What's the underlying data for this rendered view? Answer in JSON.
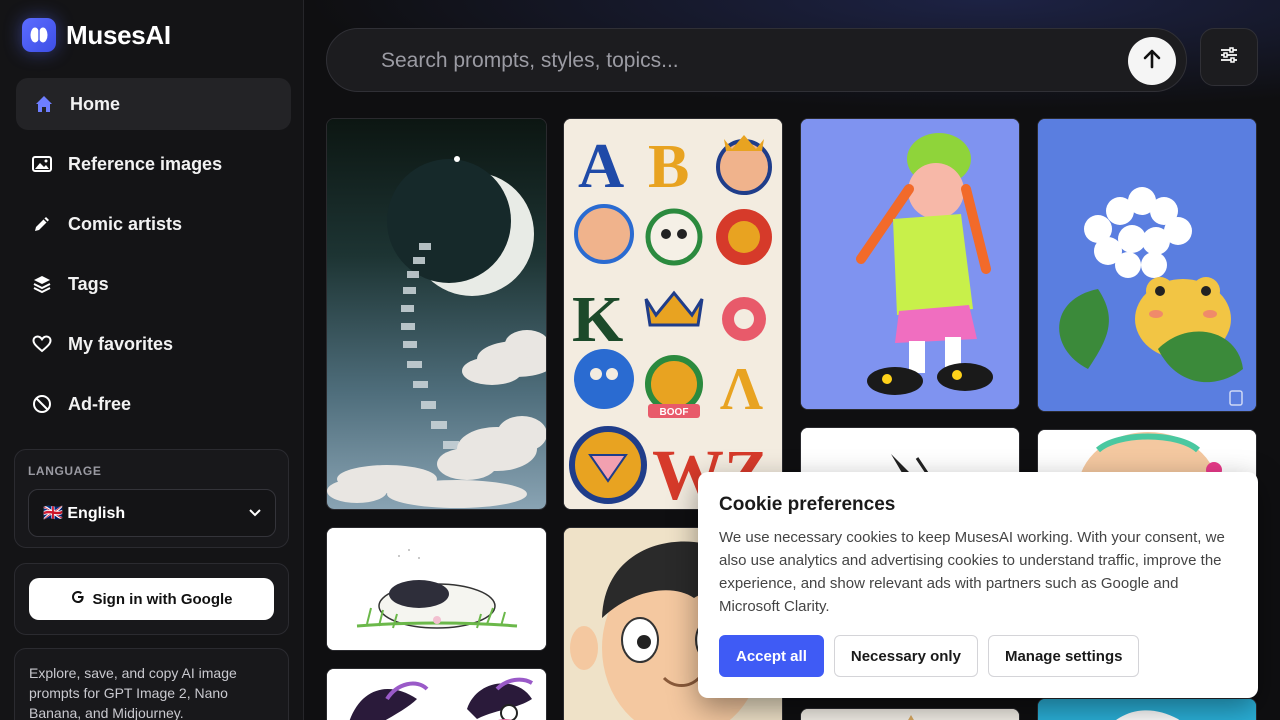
{
  "brand": {
    "name": "MusesAI"
  },
  "nav": [
    {
      "label": "Home",
      "icon": "home-icon",
      "active": true
    },
    {
      "label": "Reference images",
      "icon": "image-icon"
    },
    {
      "label": "Comic artists",
      "icon": "pencil-icon"
    },
    {
      "label": "Tags",
      "icon": "layers-icon"
    },
    {
      "label": "My favorites",
      "icon": "heart-icon"
    },
    {
      "label": "Ad-free",
      "icon": "ban-icon"
    }
  ],
  "language": {
    "label": "LANGUAGE",
    "selected": "🇬🇧 English"
  },
  "signin": {
    "label": "Sign in with Google"
  },
  "about": {
    "text": "Explore, save, and copy AI image prompts for GPT Image 2, Nano Banana, and Midjourney."
  },
  "search": {
    "placeholder": "Search prompts, styles, topics..."
  },
  "cookie": {
    "title": "Cookie preferences",
    "body": "We use necessary cookies to keep MusesAI working. With your consent, we also use analytics and advertising cookies to understand traffic, improve the experience, and show relevant ads with partners such as Google and Microsoft Clarity.",
    "accept": "Accept all",
    "necessary": "Necessary only",
    "manage": "Manage settings"
  },
  "colors": {
    "accent": "#3f5bf5",
    "brand": "#5b6cff",
    "background": "#0f0f11"
  },
  "tattoo_letters": [
    "A",
    "B",
    "K",
    "Λ",
    "W",
    "Z"
  ],
  "tattoo_banner": "BOOF"
}
